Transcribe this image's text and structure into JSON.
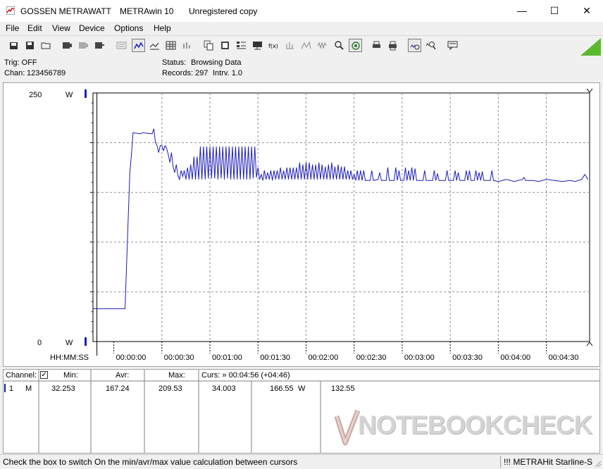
{
  "window": {
    "brand": "GOSSEN METRAWATT",
    "app": "METRAwin 10",
    "license": "Unregistered copy",
    "controls": {
      "minimize": "—",
      "maximize": "☐",
      "close": "✕"
    }
  },
  "menu": [
    "File",
    "Edit",
    "View",
    "Device",
    "Options",
    "Help"
  ],
  "info": {
    "trig_label": "Trig: OFF",
    "chan_label": "Chan:",
    "chan_value": "123456789",
    "status_label": "Status:",
    "status_value": "Browsing Data",
    "records_label": "Records: 297",
    "interval_label": "Intrv. 1.0"
  },
  "chart_data": {
    "type": "line",
    "y_unit": "W",
    "y_max_label": "250",
    "y_min_label": "0",
    "ylim": [
      0,
      250
    ],
    "x_axis_label": "HH:MM:SS",
    "x_ticks": [
      "00:00:00",
      "00:00:30",
      "00:01:00",
      "00:01:30",
      "00:02:00",
      "00:02:30",
      "00:03:00",
      "00:03:30",
      "00:04:00",
      "00:04:30"
    ],
    "xlim_seconds": [
      -13,
      297
    ],
    "grid": true,
    "line_color": "#1c1cb8",
    "cursor_at_seconds": 0,
    "series_points": [
      [
        -13,
        33
      ],
      [
        6,
        33
      ],
      [
        7,
        33
      ],
      [
        10,
        170
      ],
      [
        11,
        188
      ],
      [
        12,
        210
      ],
      [
        17,
        209
      ],
      [
        18,
        210
      ],
      [
        24,
        209
      ],
      [
        25,
        214
      ],
      [
        26,
        200
      ],
      [
        27,
        197
      ],
      [
        28,
        190
      ],
      [
        29,
        197
      ],
      [
        30,
        197
      ],
      [
        31,
        192
      ],
      [
        32,
        197
      ],
      [
        33,
        194
      ],
      [
        34,
        188
      ],
      [
        35,
        180
      ],
      [
        36,
        190
      ],
      [
        37,
        176
      ],
      [
        38,
        170
      ],
      [
        39,
        178
      ],
      [
        40,
        167
      ],
      [
        41,
        163
      ],
      [
        42,
        172
      ],
      [
        43,
        166
      ],
      [
        44,
        172
      ],
      [
        45,
        163
      ],
      [
        46,
        175
      ],
      [
        47,
        163
      ],
      [
        48,
        178
      ],
      [
        49,
        163
      ],
      [
        50,
        186
      ],
      [
        51,
        163
      ],
      [
        52,
        186
      ],
      [
        53,
        163
      ],
      [
        54,
        196
      ],
      [
        55,
        163
      ],
      [
        56,
        196
      ],
      [
        57,
        163
      ],
      [
        58,
        196
      ],
      [
        59,
        164
      ],
      [
        60,
        196
      ],
      [
        61,
        164
      ],
      [
        62,
        196
      ],
      [
        63,
        164
      ],
      [
        64,
        196
      ],
      [
        65,
        163
      ],
      [
        66,
        196
      ],
      [
        67,
        164
      ],
      [
        68,
        196
      ],
      [
        69,
        163
      ],
      [
        70,
        196
      ],
      [
        71,
        164
      ],
      [
        72,
        196
      ],
      [
        73,
        163
      ],
      [
        74,
        196
      ],
      [
        75,
        163
      ],
      [
        76,
        196
      ],
      [
        77,
        163
      ],
      [
        78,
        196
      ],
      [
        79,
        163
      ],
      [
        80,
        196
      ],
      [
        81,
        163
      ],
      [
        82,
        196
      ],
      [
        83,
        163
      ],
      [
        84,
        196
      ],
      [
        85,
        163
      ],
      [
        86,
        196
      ],
      [
        87,
        164
      ],
      [
        88,
        196
      ],
      [
        89,
        165
      ],
      [
        90,
        175
      ],
      [
        91,
        163
      ],
      [
        92,
        168
      ],
      [
        93,
        162
      ],
      [
        94,
        172
      ],
      [
        95,
        163
      ],
      [
        96,
        170
      ],
      [
        97,
        163
      ],
      [
        98,
        172
      ],
      [
        99,
        162
      ],
      [
        100,
        172
      ],
      [
        101,
        163
      ],
      [
        102,
        172
      ],
      [
        103,
        163
      ],
      [
        104,
        175
      ],
      [
        105,
        163
      ],
      [
        106,
        172
      ],
      [
        107,
        163
      ],
      [
        108,
        175
      ],
      [
        109,
        163
      ],
      [
        110,
        175
      ],
      [
        111,
        163
      ],
      [
        112,
        175
      ],
      [
        113,
        163
      ],
      [
        114,
        175
      ],
      [
        115,
        163
      ],
      [
        116,
        180
      ],
      [
        117,
        163
      ],
      [
        118,
        178
      ],
      [
        119,
        163
      ],
      [
        120,
        180
      ],
      [
        121,
        163
      ],
      [
        122,
        180
      ],
      [
        123,
        163
      ],
      [
        124,
        178
      ],
      [
        125,
        163
      ],
      [
        126,
        178
      ],
      [
        127,
        163
      ],
      [
        128,
        180
      ],
      [
        129,
        163
      ],
      [
        130,
        178
      ],
      [
        131,
        163
      ],
      [
        132,
        176
      ],
      [
        133,
        163
      ],
      [
        134,
        178
      ],
      [
        135,
        163
      ],
      [
        136,
        180
      ],
      [
        137,
        163
      ],
      [
        138,
        176
      ],
      [
        139,
        163
      ],
      [
        140,
        178
      ],
      [
        141,
        163
      ],
      [
        142,
        176
      ],
      [
        143,
        163
      ],
      [
        144,
        176
      ],
      [
        145,
        163
      ],
      [
        146,
        172
      ],
      [
        147,
        163
      ],
      [
        148,
        172
      ],
      [
        149,
        163
      ],
      [
        150,
        168
      ],
      [
        151,
        162
      ],
      [
        152,
        172
      ],
      [
        153,
        162
      ],
      [
        154,
        172
      ],
      [
        155,
        162
      ],
      [
        156,
        172
      ],
      [
        157,
        162
      ],
      [
        160,
        162
      ],
      [
        161,
        172
      ],
      [
        162,
        162
      ],
      [
        165,
        163
      ],
      [
        166,
        170
      ],
      [
        167,
        162
      ],
      [
        170,
        162
      ],
      [
        171,
        175
      ],
      [
        172,
        162
      ],
      [
        175,
        162
      ],
      [
        176,
        175
      ],
      [
        177,
        162
      ],
      [
        178,
        172
      ],
      [
        179,
        162
      ],
      [
        181,
        162
      ],
      [
        182,
        175
      ],
      [
        183,
        162
      ],
      [
        184,
        172
      ],
      [
        185,
        162
      ],
      [
        186,
        175
      ],
      [
        187,
        162
      ],
      [
        188,
        174
      ],
      [
        189,
        162
      ],
      [
        193,
        162
      ],
      [
        194,
        172
      ],
      [
        195,
        162
      ],
      [
        199,
        162
      ],
      [
        200,
        172
      ],
      [
        201,
        162
      ],
      [
        202,
        169
      ],
      [
        203,
        162
      ],
      [
        207,
        162
      ],
      [
        208,
        172
      ],
      [
        209,
        162
      ],
      [
        212,
        162
      ],
      [
        213,
        172
      ],
      [
        214,
        162
      ],
      [
        215,
        170
      ],
      [
        216,
        162
      ],
      [
        219,
        162
      ],
      [
        220,
        172
      ],
      [
        221,
        162
      ],
      [
        222,
        172
      ],
      [
        223,
        162
      ],
      [
        225,
        162
      ],
      [
        226,
        172
      ],
      [
        227,
        162
      ],
      [
        228,
        170
      ],
      [
        229,
        162
      ],
      [
        230,
        171
      ],
      [
        231,
        162
      ],
      [
        235,
        162
      ],
      [
        236,
        172
      ],
      [
        237,
        162
      ],
      [
        240,
        161
      ],
      [
        245,
        163
      ],
      [
        250,
        161
      ],
      [
        255,
        163
      ],
      [
        256,
        165
      ],
      [
        257,
        162
      ],
      [
        260,
        162
      ],
      [
        262,
        162
      ],
      [
        265,
        161
      ],
      [
        270,
        163
      ],
      [
        275,
        162
      ],
      [
        280,
        161
      ],
      [
        285,
        162
      ],
      [
        288,
        161
      ],
      [
        292,
        163
      ],
      [
        294,
        168
      ],
      [
        296,
        163
      ]
    ]
  },
  "stats": {
    "headers": {
      "channel": "Channel:",
      "min": "Min:",
      "avr": "Avr:",
      "max": "Max:",
      "curs": "Curs: » 00:04:56 (+04:46)"
    },
    "row": {
      "index": "1",
      "mode": "M",
      "min": "32.253",
      "avr": "167.24",
      "max": "209.53",
      "curs_value": "34.003",
      "curs_avg": "166.55",
      "unit": "W",
      "extra": "132.55"
    }
  },
  "watermark": "NOTEBOOKCHECK",
  "statusbar": {
    "hint": "Check the box to switch On the min/avr/max value calculation between cursors",
    "device": "!!! METRAHit Starline-S"
  }
}
